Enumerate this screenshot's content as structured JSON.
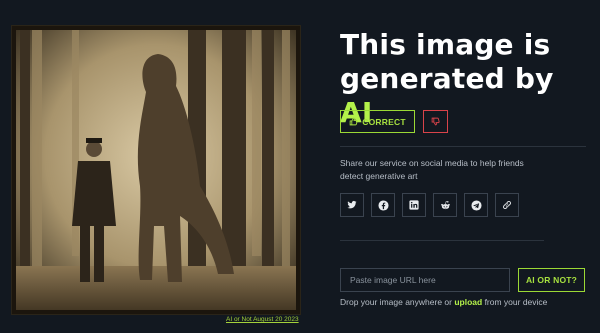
{
  "result": {
    "headline_prefix": "This image is generated by ",
    "headline_highlight": "AI"
  },
  "feedback": {
    "correct_label": "CORRECT",
    "correct_icon": "thumbs-up-icon",
    "incorrect_icon": "thumbs-down-icon"
  },
  "image": {
    "caption": "AI or Not August 20 2023"
  },
  "share": {
    "text": "Share our service on social media to help friends detect generative art",
    "buttons": [
      {
        "name": "twitter",
        "icon": "twitter-icon"
      },
      {
        "name": "facebook",
        "icon": "facebook-icon"
      },
      {
        "name": "linkedin",
        "icon": "linkedin-icon"
      },
      {
        "name": "reddit",
        "icon": "reddit-icon"
      },
      {
        "name": "telegram",
        "icon": "telegram-icon"
      },
      {
        "name": "copy-link",
        "icon": "link-icon"
      }
    ]
  },
  "check": {
    "placeholder": "Paste image URL here",
    "button_label": "AI OR NOT?",
    "drop_prefix": "Drop your image anywhere or ",
    "drop_link": "upload",
    "drop_suffix": " from your device"
  },
  "colors": {
    "background": "#121820",
    "accent": "#b4f14a",
    "danger": "#d9434a"
  }
}
